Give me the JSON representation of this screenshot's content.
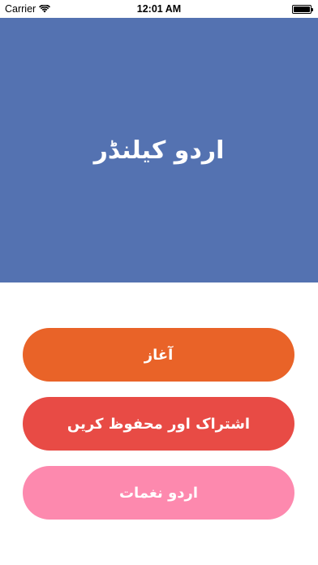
{
  "status_bar": {
    "carrier": "Carrier",
    "wifi_icon": "wifi-icon",
    "time": "12:01 AM",
    "battery_icon": "battery-icon",
    "battery_level": 1.0
  },
  "header": {
    "title": "اردو کیلنڈر",
    "background": "#5472B1"
  },
  "buttons": [
    {
      "label": "آغاز",
      "color": "#E96328"
    },
    {
      "label": "اشتراک اور محفوظ کریں",
      "color": "#E84B45"
    },
    {
      "label": "اردو نغمات",
      "color": "#FD89AE"
    }
  ]
}
